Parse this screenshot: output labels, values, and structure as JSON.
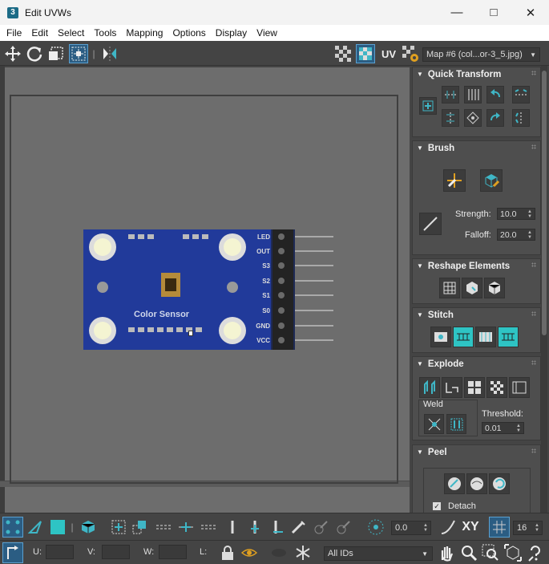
{
  "window": {
    "app_icon_text": "3",
    "title": "Edit UVWs"
  },
  "menu": [
    "File",
    "Edit",
    "Select",
    "Tools",
    "Mapping",
    "Options",
    "Display",
    "View"
  ],
  "toolbar": {
    "uv_label": "UV",
    "map_select": "Map #6 (col...or-3_5.jpg)"
  },
  "image": {
    "pins": [
      "LED",
      "OUT",
      "S3",
      "S2",
      "S1",
      "S0",
      "GND",
      "VCC"
    ],
    "board_label": "Color Sensor"
  },
  "panels": {
    "quick_transform": {
      "title": "Quick Transform"
    },
    "brush": {
      "title": "Brush",
      "strength_label": "Strength:",
      "strength_value": "10.0",
      "falloff_label": "Falloff:",
      "falloff_value": "20.0"
    },
    "reshape": {
      "title": "Reshape Elements"
    },
    "stitch": {
      "title": "Stitch"
    },
    "explode": {
      "title": "Explode",
      "weld_label": "Weld",
      "threshold_label": "Threshold:",
      "threshold_value": "0.01"
    },
    "peel": {
      "title": "Peel",
      "detach_label": "Detach"
    }
  },
  "bottom": {
    "rotation_value": "0.0",
    "xy_label": "XY",
    "grid_value": "16",
    "u_label": "U:",
    "v_label": "V:",
    "w_label": "W:",
    "l_label": "L:",
    "ids_select": "All IDs"
  },
  "colors": {
    "accent": "#3fb6c6",
    "teal_fill": "#2ec4c4",
    "board": "#213a9a"
  }
}
